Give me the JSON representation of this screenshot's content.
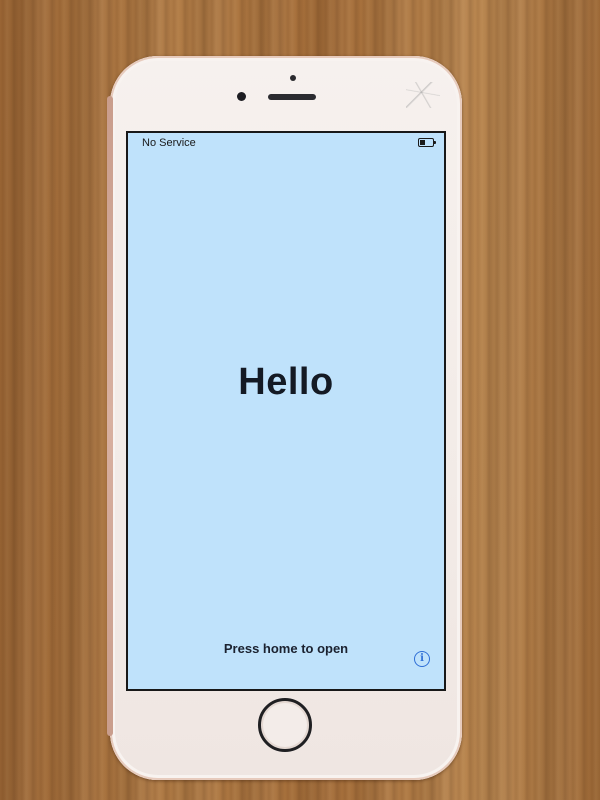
{
  "status_bar": {
    "carrier": "No Service"
  },
  "lock_screen": {
    "greeting": "Hello",
    "instruction": "Press home to open",
    "info_symbol": "i"
  },
  "icons": {
    "battery": "battery-icon",
    "info": "info-icon",
    "home_button": "home-button"
  },
  "colors": {
    "screen_background": "#bfe2fb",
    "greeting_text": "#141a24",
    "info_accent": "#2f6fd6",
    "phone_body": "#f5efec"
  }
}
